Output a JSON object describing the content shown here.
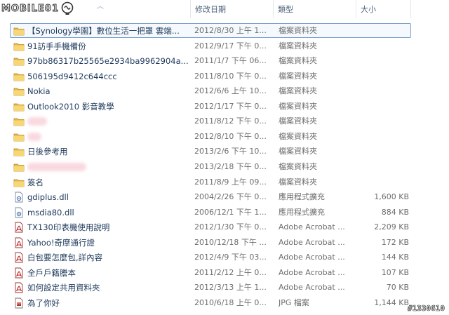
{
  "logo": {
    "text": "MOBILE01"
  },
  "columns": {
    "name": "",
    "date": "修改日期",
    "type": "類型",
    "size": "大小"
  },
  "files": [
    {
      "name": "【Synology學園】數位生活一把罩 雲端...",
      "date": "2012/8/30 上午 1...",
      "type": "檔案資料夾",
      "size": "",
      "icon": "folder",
      "selected": true
    },
    {
      "name": "91訪手手機備份",
      "date": "2012/9/17 下午 0...",
      "type": "檔案資料夾",
      "size": "",
      "icon": "folder"
    },
    {
      "name": "97bb86317b25565e2934ba9962904a...",
      "date": "2011/1/7 下午 06...",
      "type": "檔案資料夾",
      "size": "",
      "icon": "folder"
    },
    {
      "name": "506195d9412c644ccc",
      "date": "2011/8/10 下午 0...",
      "type": "檔案資料夾",
      "size": "",
      "icon": "folder"
    },
    {
      "name": "Nokia",
      "date": "2012/6/6 上午 10...",
      "type": "檔案資料夾",
      "size": "",
      "icon": "folder"
    },
    {
      "name": "Outlook2010 影音教學",
      "date": "2012/1/17 下午 0...",
      "type": "檔案資料夾",
      "size": "",
      "icon": "folder"
    },
    {
      "name": "",
      "date": "2011/8/12 下午 0...",
      "type": "檔案資料夾",
      "size": "",
      "icon": "folder",
      "redacted": true
    },
    {
      "name": "",
      "date": "2012/8/10 下午 0...",
      "type": "檔案資料夾",
      "size": "",
      "icon": "folder",
      "redacted": true
    },
    {
      "name": "日後參考用",
      "date": "2013/2/6 下午 10...",
      "type": "檔案資料夾",
      "size": "",
      "icon": "folder"
    },
    {
      "name": "",
      "date": "2013/2/18 下午 0...",
      "type": "檔案資料夾",
      "size": "",
      "icon": "folder",
      "redacted": true
    },
    {
      "name": "簽名",
      "date": "2011/8/9 上午 09...",
      "type": "檔案資料夾",
      "size": "",
      "icon": "folder"
    },
    {
      "name": "gdiplus.dll",
      "date": "2004/2/26 下午 0...",
      "type": "應用程式擴充",
      "size": "1,600 KB",
      "icon": "dll"
    },
    {
      "name": "msdia80.dll",
      "date": "2006/12/1 下午 1...",
      "type": "應用程式擴充",
      "size": "884 KB",
      "icon": "dll"
    },
    {
      "name": "TX130印表機使用說明",
      "date": "2012/1/30 下午 0...",
      "type": "Adobe Acrobat ...",
      "size": "2,209 KB",
      "icon": "pdf"
    },
    {
      "name": "Yahoo!奇摩通行證",
      "date": "2010/12/18 下午 ...",
      "type": "Adobe Acrobat ...",
      "size": "172 KB",
      "icon": "pdf"
    },
    {
      "name": "白包要怎麼包,詳內容",
      "date": "2012/4/9 下午 03...",
      "type": "Adobe Acrobat ...",
      "size": "144 KB",
      "icon": "pdf"
    },
    {
      "name": "全戶戶籍謄本",
      "date": "2011/2/12 上午 0...",
      "type": "Adobe Acrobat ...",
      "size": "107 KB",
      "icon": "pdf"
    },
    {
      "name": "如何設定共用資料夾",
      "date": "2012/3/13 上午 1...",
      "type": "Adobe Acrobat ...",
      "size": "70 KB",
      "icon": "pdf"
    },
    {
      "name": "為了你好",
      "date": "2010/6/18 上午 0...",
      "type": "JPG 檔案",
      "size": "1,144 KB",
      "icon": "jpg"
    }
  ],
  "watermark": "#1330610"
}
